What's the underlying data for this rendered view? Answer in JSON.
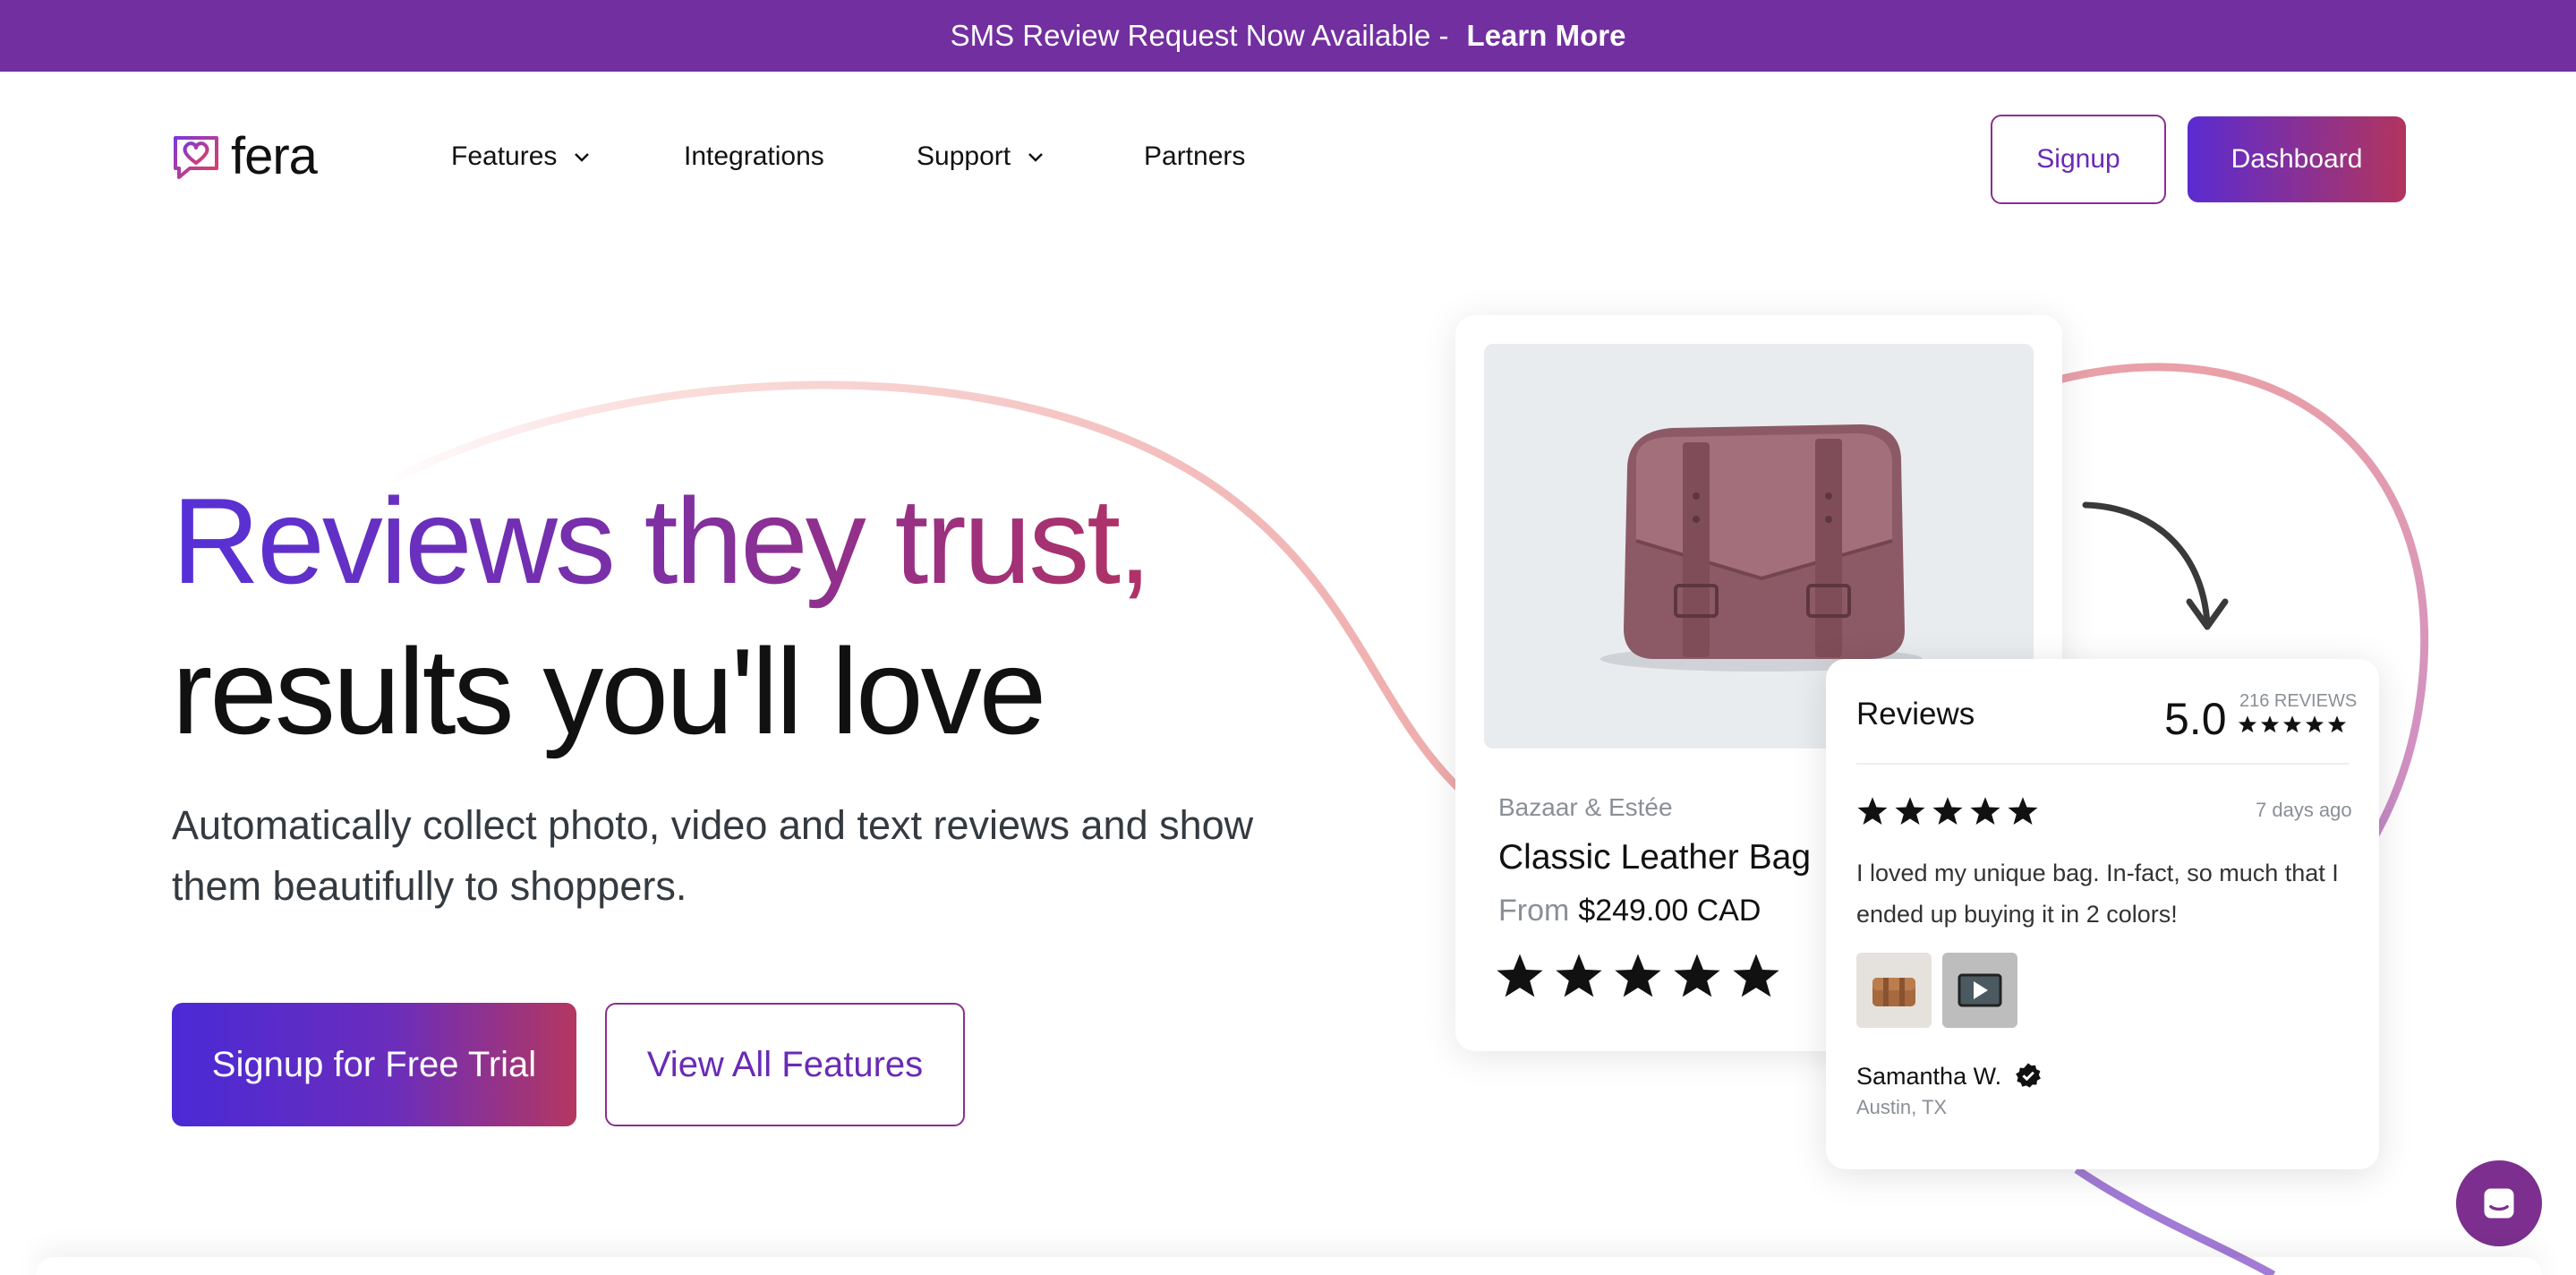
{
  "announcement": {
    "text": "SMS Review Request Now Available -",
    "link": "Learn More"
  },
  "logo": {
    "text": "fera"
  },
  "nav": {
    "features": "Features",
    "integrations": "Integrations",
    "support": "Support",
    "partners": "Partners",
    "signup": "Signup",
    "dashboard": "Dashboard"
  },
  "hero": {
    "headline_line1": "Reviews they trust,",
    "headline_line2": "results you'll love",
    "subtitle": "Automatically collect photo, video and text reviews and show them beautifully to shoppers.",
    "cta_primary": "Signup for Free Trial",
    "cta_secondary": "View All Features"
  },
  "product": {
    "brand": "Bazaar & Estée",
    "name": "Classic Leather Bag",
    "price_prefix": "From",
    "price": "$249.00 CAD",
    "rating_stars": 5
  },
  "reviews_widget": {
    "title": "Reviews",
    "score": "5.0",
    "count": "216 REVIEWS",
    "review": {
      "stars": 5,
      "date": "7 days ago",
      "text": "I loved my unique bag. In-fact, so much that I ended up buying it in 2 colors!",
      "author": "Samantha W.",
      "location": "Austin, TX"
    }
  },
  "colors": {
    "announcement_bg": "#722fa0",
    "brand_purple": "#5b2bd1",
    "brand_rose": "#b2355e",
    "chat_bg": "#7c2f8e"
  }
}
